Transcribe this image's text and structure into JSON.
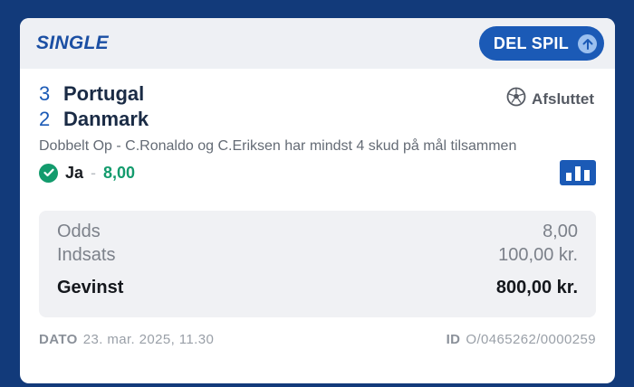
{
  "header": {
    "bet_type": "SINGLE",
    "share_label": "DEL SPIL"
  },
  "match": {
    "home": {
      "score": "3",
      "name": "Portugal"
    },
    "away": {
      "score": "2",
      "name": "Danmark"
    },
    "status": "Afsluttet"
  },
  "bet": {
    "market": "Dobbelt Op - C.Ronaldo og C.Eriksen har mindst 4 skud på mål tilsammen",
    "selection": "Ja",
    "separator": "-",
    "selection_odds": "8,00"
  },
  "summary": {
    "odds_label": "Odds",
    "odds_value": "8,00",
    "stake_label": "Indsats",
    "stake_value": "100,00 kr.",
    "win_label": "Gevinst",
    "win_value": "800,00 kr."
  },
  "footer": {
    "date_label": "DATO",
    "date_value": "23. mar. 2025, 11.30",
    "id_label": "ID",
    "id_value": "O/0465262/0000259"
  },
  "colors": {
    "background": "#123a7a",
    "brand_blue": "#1b5ab6",
    "won_green": "#139b6d"
  },
  "icons": [
    "arrow-up-icon",
    "football-icon",
    "check-circle-icon",
    "bar-chart-icon"
  ]
}
